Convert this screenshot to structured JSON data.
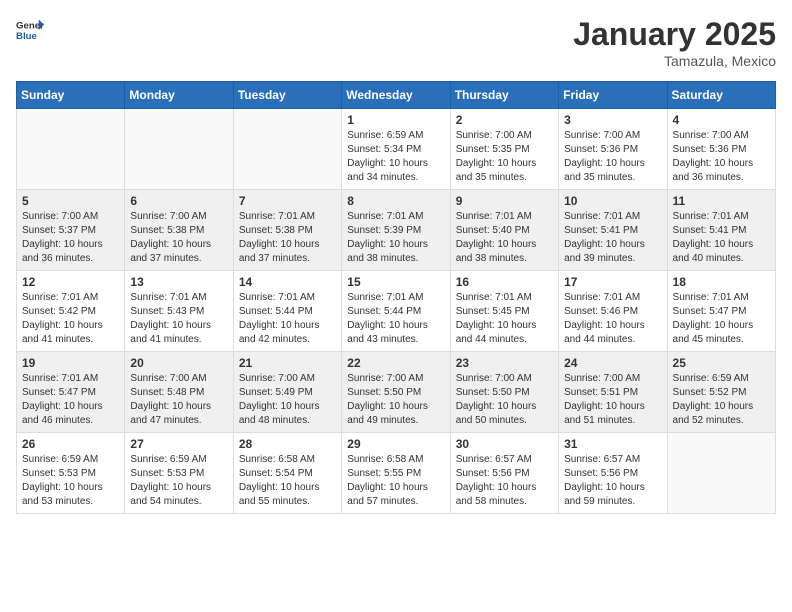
{
  "header": {
    "logo_general": "General",
    "logo_blue": "Blue",
    "title": "January 2025",
    "location": "Tamazula, Mexico"
  },
  "days_of_week": [
    "Sunday",
    "Monday",
    "Tuesday",
    "Wednesday",
    "Thursday",
    "Friday",
    "Saturday"
  ],
  "weeks": [
    [
      {
        "day": "",
        "info": ""
      },
      {
        "day": "",
        "info": ""
      },
      {
        "day": "",
        "info": ""
      },
      {
        "day": "1",
        "info": "Sunrise: 6:59 AM\nSunset: 5:34 PM\nDaylight: 10 hours and 34 minutes."
      },
      {
        "day": "2",
        "info": "Sunrise: 7:00 AM\nSunset: 5:35 PM\nDaylight: 10 hours and 35 minutes."
      },
      {
        "day": "3",
        "info": "Sunrise: 7:00 AM\nSunset: 5:36 PM\nDaylight: 10 hours and 35 minutes."
      },
      {
        "day": "4",
        "info": "Sunrise: 7:00 AM\nSunset: 5:36 PM\nDaylight: 10 hours and 36 minutes."
      }
    ],
    [
      {
        "day": "5",
        "info": "Sunrise: 7:00 AM\nSunset: 5:37 PM\nDaylight: 10 hours and 36 minutes."
      },
      {
        "day": "6",
        "info": "Sunrise: 7:00 AM\nSunset: 5:38 PM\nDaylight: 10 hours and 37 minutes."
      },
      {
        "day": "7",
        "info": "Sunrise: 7:01 AM\nSunset: 5:38 PM\nDaylight: 10 hours and 37 minutes."
      },
      {
        "day": "8",
        "info": "Sunrise: 7:01 AM\nSunset: 5:39 PM\nDaylight: 10 hours and 38 minutes."
      },
      {
        "day": "9",
        "info": "Sunrise: 7:01 AM\nSunset: 5:40 PM\nDaylight: 10 hours and 38 minutes."
      },
      {
        "day": "10",
        "info": "Sunrise: 7:01 AM\nSunset: 5:41 PM\nDaylight: 10 hours and 39 minutes."
      },
      {
        "day": "11",
        "info": "Sunrise: 7:01 AM\nSunset: 5:41 PM\nDaylight: 10 hours and 40 minutes."
      }
    ],
    [
      {
        "day": "12",
        "info": "Sunrise: 7:01 AM\nSunset: 5:42 PM\nDaylight: 10 hours and 41 minutes."
      },
      {
        "day": "13",
        "info": "Sunrise: 7:01 AM\nSunset: 5:43 PM\nDaylight: 10 hours and 41 minutes."
      },
      {
        "day": "14",
        "info": "Sunrise: 7:01 AM\nSunset: 5:44 PM\nDaylight: 10 hours and 42 minutes."
      },
      {
        "day": "15",
        "info": "Sunrise: 7:01 AM\nSunset: 5:44 PM\nDaylight: 10 hours and 43 minutes."
      },
      {
        "day": "16",
        "info": "Sunrise: 7:01 AM\nSunset: 5:45 PM\nDaylight: 10 hours and 44 minutes."
      },
      {
        "day": "17",
        "info": "Sunrise: 7:01 AM\nSunset: 5:46 PM\nDaylight: 10 hours and 44 minutes."
      },
      {
        "day": "18",
        "info": "Sunrise: 7:01 AM\nSunset: 5:47 PM\nDaylight: 10 hours and 45 minutes."
      }
    ],
    [
      {
        "day": "19",
        "info": "Sunrise: 7:01 AM\nSunset: 5:47 PM\nDaylight: 10 hours and 46 minutes."
      },
      {
        "day": "20",
        "info": "Sunrise: 7:00 AM\nSunset: 5:48 PM\nDaylight: 10 hours and 47 minutes."
      },
      {
        "day": "21",
        "info": "Sunrise: 7:00 AM\nSunset: 5:49 PM\nDaylight: 10 hours and 48 minutes."
      },
      {
        "day": "22",
        "info": "Sunrise: 7:00 AM\nSunset: 5:50 PM\nDaylight: 10 hours and 49 minutes."
      },
      {
        "day": "23",
        "info": "Sunrise: 7:00 AM\nSunset: 5:50 PM\nDaylight: 10 hours and 50 minutes."
      },
      {
        "day": "24",
        "info": "Sunrise: 7:00 AM\nSunset: 5:51 PM\nDaylight: 10 hours and 51 minutes."
      },
      {
        "day": "25",
        "info": "Sunrise: 6:59 AM\nSunset: 5:52 PM\nDaylight: 10 hours and 52 minutes."
      }
    ],
    [
      {
        "day": "26",
        "info": "Sunrise: 6:59 AM\nSunset: 5:53 PM\nDaylight: 10 hours and 53 minutes."
      },
      {
        "day": "27",
        "info": "Sunrise: 6:59 AM\nSunset: 5:53 PM\nDaylight: 10 hours and 54 minutes."
      },
      {
        "day": "28",
        "info": "Sunrise: 6:58 AM\nSunset: 5:54 PM\nDaylight: 10 hours and 55 minutes."
      },
      {
        "day": "29",
        "info": "Sunrise: 6:58 AM\nSunset: 5:55 PM\nDaylight: 10 hours and 57 minutes."
      },
      {
        "day": "30",
        "info": "Sunrise: 6:57 AM\nSunset: 5:56 PM\nDaylight: 10 hours and 58 minutes."
      },
      {
        "day": "31",
        "info": "Sunrise: 6:57 AM\nSunset: 5:56 PM\nDaylight: 10 hours and 59 minutes."
      },
      {
        "day": "",
        "info": ""
      }
    ]
  ]
}
